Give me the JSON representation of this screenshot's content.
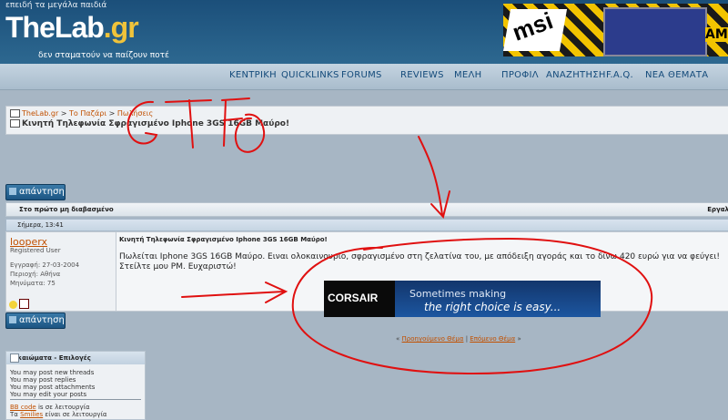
{
  "header": {
    "tagline_top": "επειδή τα μεγάλα παιδιά",
    "logo_main": "TheLab",
    "logo_suffix": ".gr",
    "tagline_bottom": "δεν σταματούν να παίζουν ποτέ"
  },
  "banner": {
    "brand": "msi",
    "side_text": "AMD"
  },
  "nav": {
    "items": [
      "ΚΕΝΤΡΙΚΗ",
      "QUICKLINKS",
      "FORUMS",
      "REVIEWS",
      "ΜΕΛΗ",
      "ΠΡΟΦΙΛ",
      "ΑΝΑΖΗΤΗΣΗ",
      "F.A.Q.",
      "ΝΕΑ ΘΕΜΑΤΑ"
    ]
  },
  "breadcrumb": {
    "items": [
      "TheLab.gr",
      "Το Παζάρι",
      "Πωλήσεις"
    ],
    "separator": ">",
    "title": "Κινητή Τηλεφωνία Σφραγισμένο Iphone 3GS 16GB Μαύρο!"
  },
  "buttons": {
    "reply": "απάντηση"
  },
  "thread_tools": {
    "first_unread": "Στο πρώτο μη διαβασμένο",
    "right": "Εργαλ"
  },
  "post": {
    "date": "Σήμερα, 13:41",
    "username": "looperx",
    "user_title": "Registered User",
    "joined": "Εγγραφή: 27-03-2004",
    "location": "Περιοχή: Αθήνα",
    "messages": "Μηνύματα: 75",
    "title": "Κινητή Τηλεφωνία Σφραγισμένο Iphone 3GS 16GB Μαύρο!",
    "text": "Πωλείται Iphone 3GS 16GB Μαύρο. Ειναι ολοκαινουριο, σφραγισμένο στη ζελατίνα του, με απόδειξη αγοράς και το δίνω 420 ευρώ για να φεύγει! Στείλτε μου PM. Ευχαριστώ!"
  },
  "ad": {
    "brand": "CORSAIR",
    "line1": "Sometimes making",
    "line2": "the right choice is easy..."
  },
  "thread_nav": {
    "prev": "Προηγούμενο Θέμα",
    "divider": "|",
    "next": "Επόμενο Θέμα",
    "left_mark": "«",
    "right_mark": "»"
  },
  "permissions": {
    "title": "Δικαιώματα - Επιλογές",
    "lines": [
      "You may post new threads",
      "You may post replies",
      "You may post attachments",
      "You may edit your posts"
    ],
    "bbcode_link": "BB code",
    "bbcode_text": "is σε λειτουργία",
    "smilies_prefix": "Τα",
    "smilies_link": "Smilies",
    "smilies_text": "είναι σε λειτουργία"
  },
  "annotation": {
    "text": "GTFO",
    "color": "#e01010"
  }
}
